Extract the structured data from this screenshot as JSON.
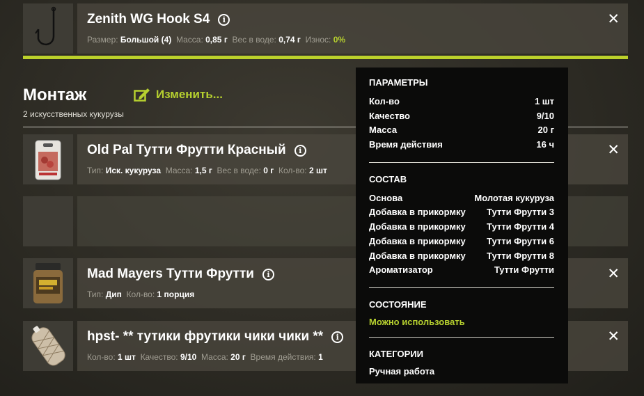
{
  "hook": {
    "title": "Zenith WG Hook S4",
    "meta": [
      {
        "label": "Размер:",
        "value": "Большой (4)"
      },
      {
        "label": "Масса:",
        "value": "0,85 г"
      },
      {
        "label": "Вес в воде:",
        "value": "0,74 г"
      },
      {
        "label": "Износ:",
        "value": "0%"
      }
    ],
    "wear_progress": 1.0
  },
  "rig": {
    "title": "Монтаж",
    "edit_label": "Изменить...",
    "subtitle": "2 искусственных кукурузы"
  },
  "items": [
    {
      "title": "Old Pal Тутти Фрутти Красный",
      "meta": [
        {
          "label": "Тип:",
          "value": "Иск. кукуруза"
        },
        {
          "label": "Масса:",
          "value": "1,5 г"
        },
        {
          "label": "Вес в воде:",
          "value": "0 г"
        },
        {
          "label": "Кол-во:",
          "value": "2 шт"
        }
      ]
    },
    {
      "title": "Mad Mayers Тутти Фрутти",
      "meta": [
        {
          "label": "Тип:",
          "value": "Дип"
        },
        {
          "label": "Кол-во:",
          "value": "1 порция"
        }
      ]
    },
    {
      "title": "hpst- ** тутики фрутики чики чики **",
      "meta": [
        {
          "label": "Кол-во:",
          "value": "1 шт"
        },
        {
          "label": "Качество:",
          "value": "9/10"
        },
        {
          "label": "Масса:",
          "value": "20 г"
        },
        {
          "label": "Время действия:",
          "value": "1"
        }
      ]
    }
  ],
  "tooltip": {
    "params_title": "ПАРАМЕТРЫ",
    "params": [
      {
        "label": "Кол-во",
        "value": "1 шт"
      },
      {
        "label": "Качество",
        "value": "9/10"
      },
      {
        "label": "Масса",
        "value": "20 г"
      },
      {
        "label": "Время действия",
        "value": "16 ч"
      }
    ],
    "composition_title": "СОСТАВ",
    "composition": [
      {
        "label": "Основа",
        "value": "Молотая кукуруза"
      },
      {
        "label": "Добавка в прикормку",
        "value": "Тутти Фрутти 3"
      },
      {
        "label": "Добавка в прикормку",
        "value": "Тутти Фрутти 4"
      },
      {
        "label": "Добавка в прикормку",
        "value": "Тутти Фрутти 6"
      },
      {
        "label": "Добавка в прикормку",
        "value": "Тутти Фрутти 8"
      },
      {
        "label": "Ароматизатор",
        "value": "Тутти Фрутти"
      }
    ],
    "state_title": "СОСТОЯНИЕ",
    "state_value": "Можно использовать",
    "categories_title": "КАТЕГОРИИ",
    "categories_value": "Ручная работа"
  },
  "icons": {
    "info": "info-icon",
    "close": "close-icon",
    "edit": "edit-icon"
  },
  "colors": {
    "accent": "#b6d02f",
    "label": "#a09d92",
    "tooltip_bg": "#0b0b0a"
  },
  "symbols": {
    "info": "i",
    "close": "✕"
  }
}
